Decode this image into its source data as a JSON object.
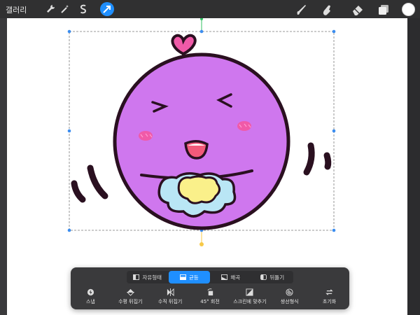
{
  "topbar": {
    "gallery_label": "갤러리",
    "left_tools": [
      {
        "icon": "wrench-icon"
      },
      {
        "icon": "magic-wand-icon"
      },
      {
        "icon": "selection-s-icon"
      },
      {
        "icon": "transform-arrow-icon",
        "active": true
      }
    ],
    "right_tools": [
      {
        "icon": "brush-icon"
      },
      {
        "icon": "smudge-icon"
      },
      {
        "icon": "eraser-icon"
      },
      {
        "icon": "layers-icon"
      }
    ],
    "current_color": "#ffffff"
  },
  "transform_panel": {
    "modes": [
      {
        "label": "자유형태",
        "icon": "freeform-icon",
        "active": false
      },
      {
        "label": "균등",
        "icon": "uniform-icon",
        "active": true
      },
      {
        "label": "왜곡",
        "icon": "distort-icon",
        "active": false
      },
      {
        "label": "뒤틀기",
        "icon": "warp-icon",
        "active": false
      }
    ],
    "actions": [
      {
        "label": "스냅",
        "icon": "snap-icon"
      },
      {
        "label": "수평 뒤집기",
        "icon": "flip-horizontal-icon"
      },
      {
        "label": "수직 뒤집기",
        "icon": "flip-vertical-icon"
      },
      {
        "label": "45° 회전",
        "icon": "rotate-45-icon"
      },
      {
        "label": "스크린에 맞추기",
        "icon": "fit-to-screen-icon"
      },
      {
        "label": "쌍선형식",
        "icon": "bilinear-icon"
      },
      {
        "label": "초기화",
        "icon": "reset-icon"
      }
    ]
  },
  "colors": {
    "accent": "#1f8fff",
    "character_fill": "#cf77ee",
    "outline": "#2a1020",
    "blush": "#f05aa8",
    "bib_yellow": "#faf08a",
    "bib_blue": "#b9e6f5"
  }
}
